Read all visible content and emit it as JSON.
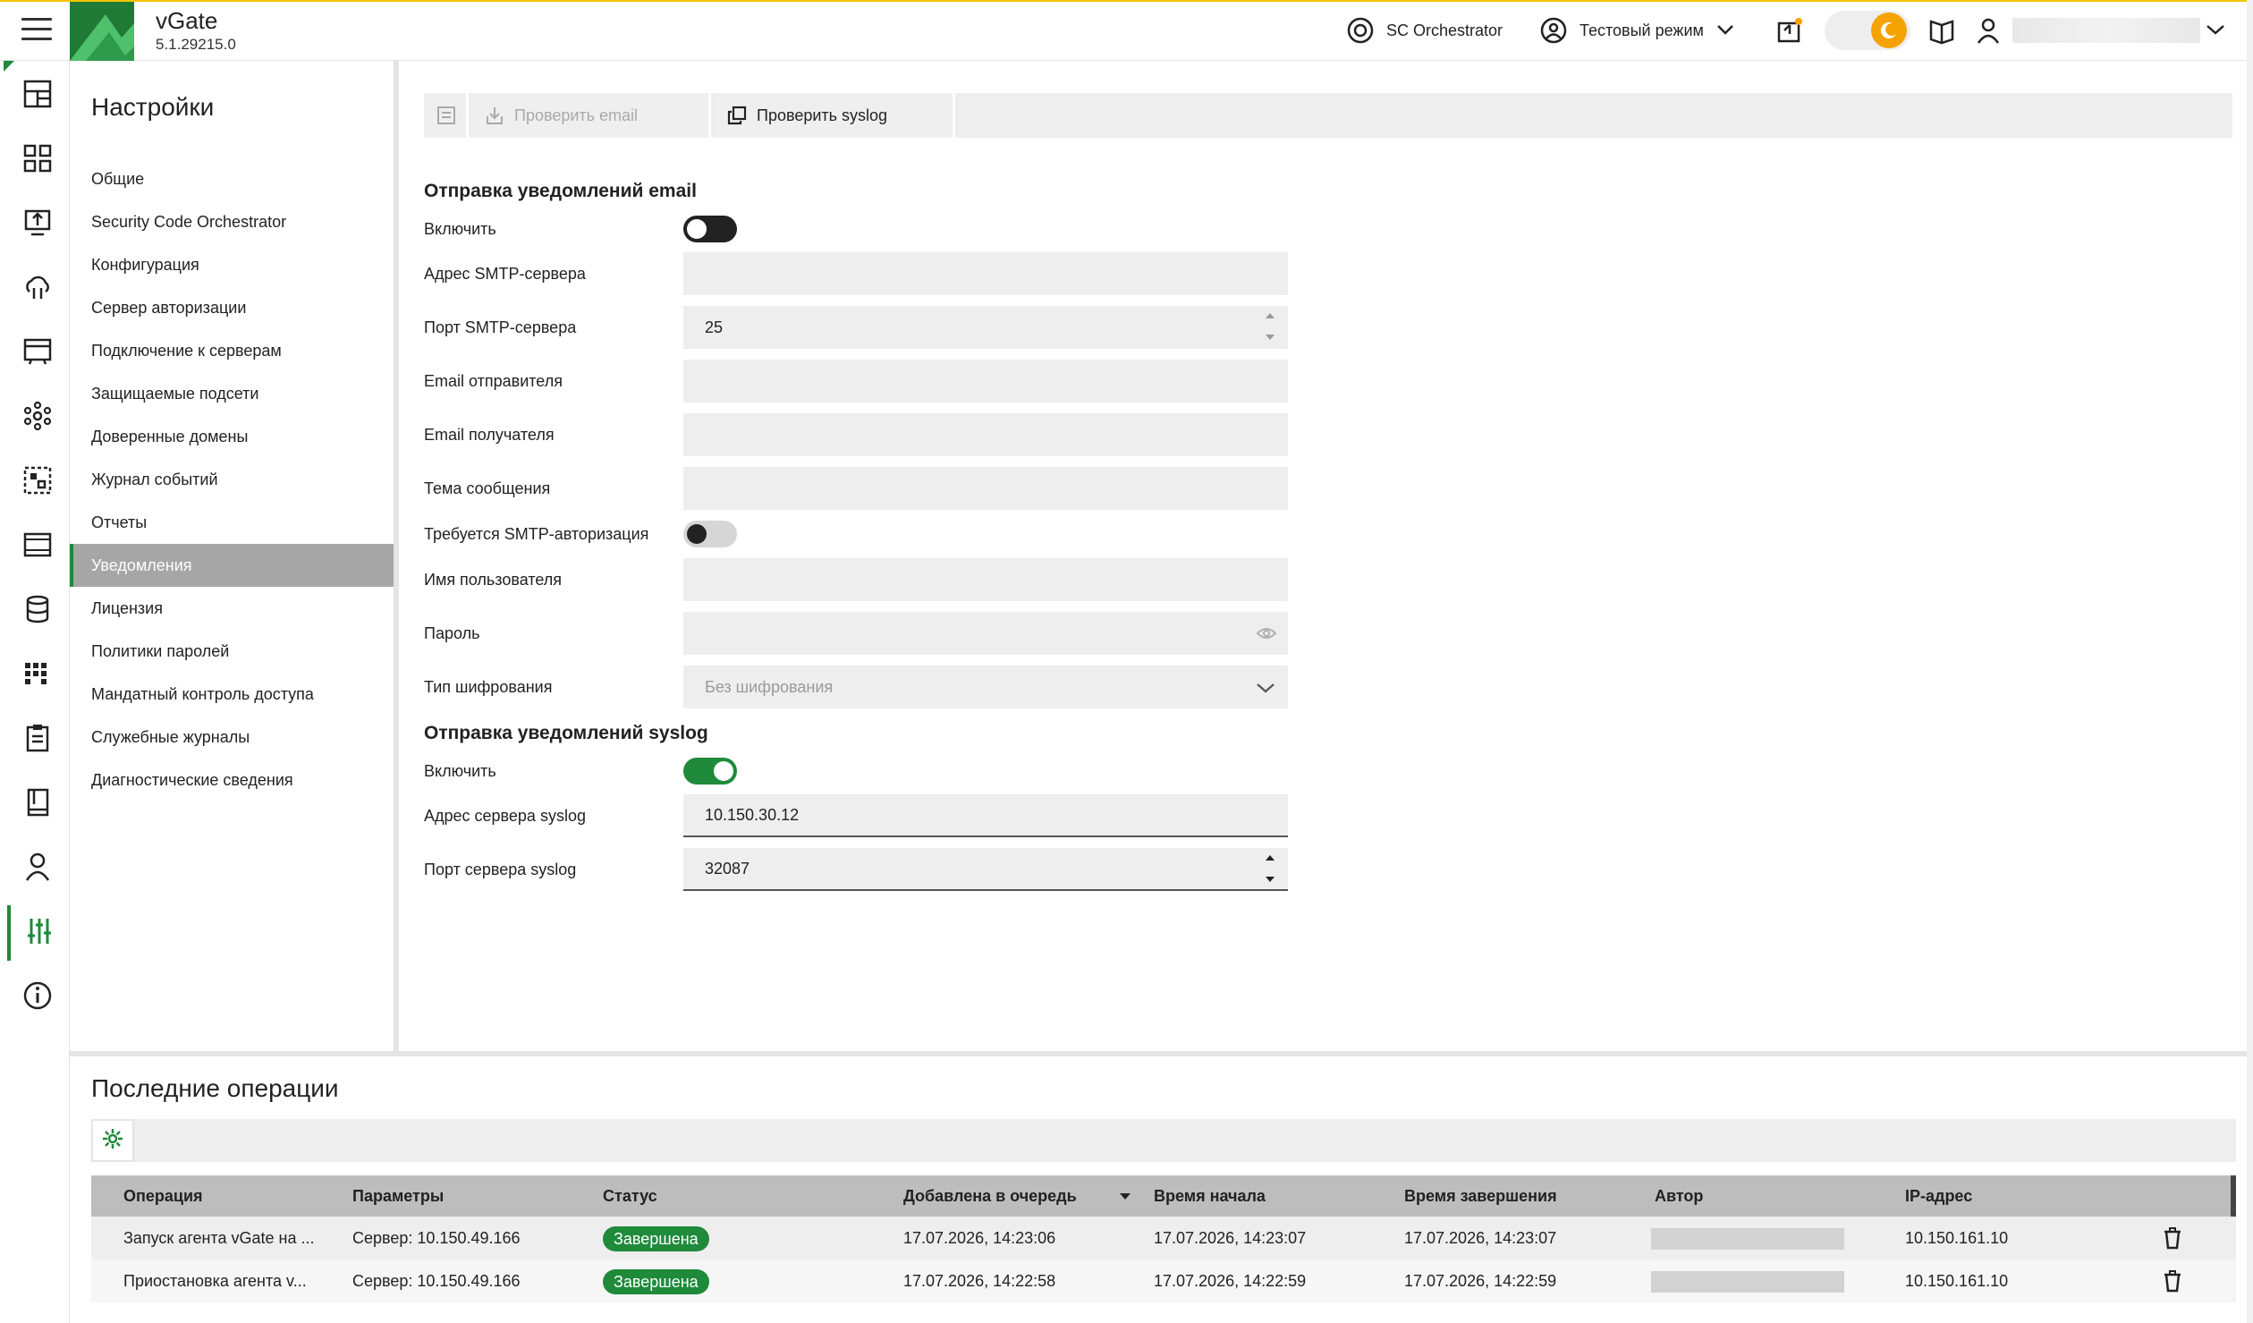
{
  "header": {
    "app_name": "vGate",
    "version": "5.1.29215.0",
    "orchestrator_label": "SC Orchestrator",
    "mode_label": "Тестовый режим",
    "theme_accent": "#f5a300"
  },
  "settings_nav": {
    "title": "Настройки",
    "items": [
      "Общие",
      "Security Code Orchestrator",
      "Конфигурация",
      "Сервер авторизации",
      "Подключение к серверам",
      "Защищаемые подсети",
      "Доверенные домены",
      "Журнал событий",
      "Отчеты",
      "Уведомления",
      "Лицензия",
      "Политики паролей",
      "Мандатный контроль доступа",
      "Служебные журналы",
      "Диагностические сведения"
    ],
    "active_item": "Уведомления"
  },
  "toolbar": {
    "check_email": "Проверить email",
    "check_syslog": "Проверить syslog"
  },
  "email_section": {
    "title": "Отправка уведомлений email",
    "enable_label": "Включить",
    "enabled": false,
    "smtp_address_label": "Адрес SMTP-сервера",
    "smtp_address": "",
    "smtp_port_label": "Порт SMTP-сервера",
    "smtp_port": "25",
    "sender_label": "Email отправителя",
    "sender": "",
    "recipient_label": "Email получателя",
    "recipient": "",
    "subject_label": "Тема сообщения",
    "subject": "",
    "smtp_auth_label": "Требуется SMTP-авторизация",
    "smtp_auth": false,
    "username_label": "Имя пользователя",
    "username": "",
    "password_label": "Пароль",
    "password": "",
    "encryption_label": "Тип шифрования",
    "encryption_value": "Без шифрования"
  },
  "syslog_section": {
    "title": "Отправка уведомлений syslog",
    "enable_label": "Включить",
    "enabled": true,
    "server_address_label": "Адрес сервера syslog",
    "server_address": "10.150.30.12",
    "server_port_label": "Порт сервера syslog",
    "server_port": "32087"
  },
  "operations": {
    "title": "Последние операции",
    "columns": [
      "Операция",
      "Параметры",
      "Статус",
      "Добавлена в очередь",
      "Время начала",
      "Время завершения",
      "Автор",
      "IP-адрес"
    ],
    "sorted_column": "Добавлена в очередь",
    "rows": [
      {
        "operation": "Запуск агента vGate на ...",
        "params": "Сервер: 10.150.49.166",
        "status": "Завершена",
        "queued": "17.07.2026, 14:23:06",
        "started": "17.07.2026, 14:23:07",
        "finished": "17.07.2026, 14:23:07",
        "ip": "10.150.161.10"
      },
      {
        "operation": "Приостановка агента v...",
        "params": "Сервер: 10.150.49.166",
        "status": "Завершена",
        "queued": "17.07.2026, 14:22:58",
        "started": "17.07.2026, 14:22:59",
        "finished": "17.07.2026, 14:22:59",
        "ip": "10.150.161.10"
      }
    ]
  },
  "colors": {
    "brand_green": "#1f8a3a",
    "header_accent": "#f5c400",
    "active_nav_bg": "#a6a6a6"
  },
  "icons": {
    "rail": [
      "dashboard-icon",
      "widgets-icon",
      "upload-server-icon",
      "cloud-network-icon",
      "terminal-icon",
      "nodes-icon",
      "grid-select-icon",
      "film-icon",
      "database-icon",
      "apps-grid-icon",
      "clipboard-icon",
      "book-icon",
      "user-icon",
      "sliders-icon",
      "info-icon"
    ]
  }
}
